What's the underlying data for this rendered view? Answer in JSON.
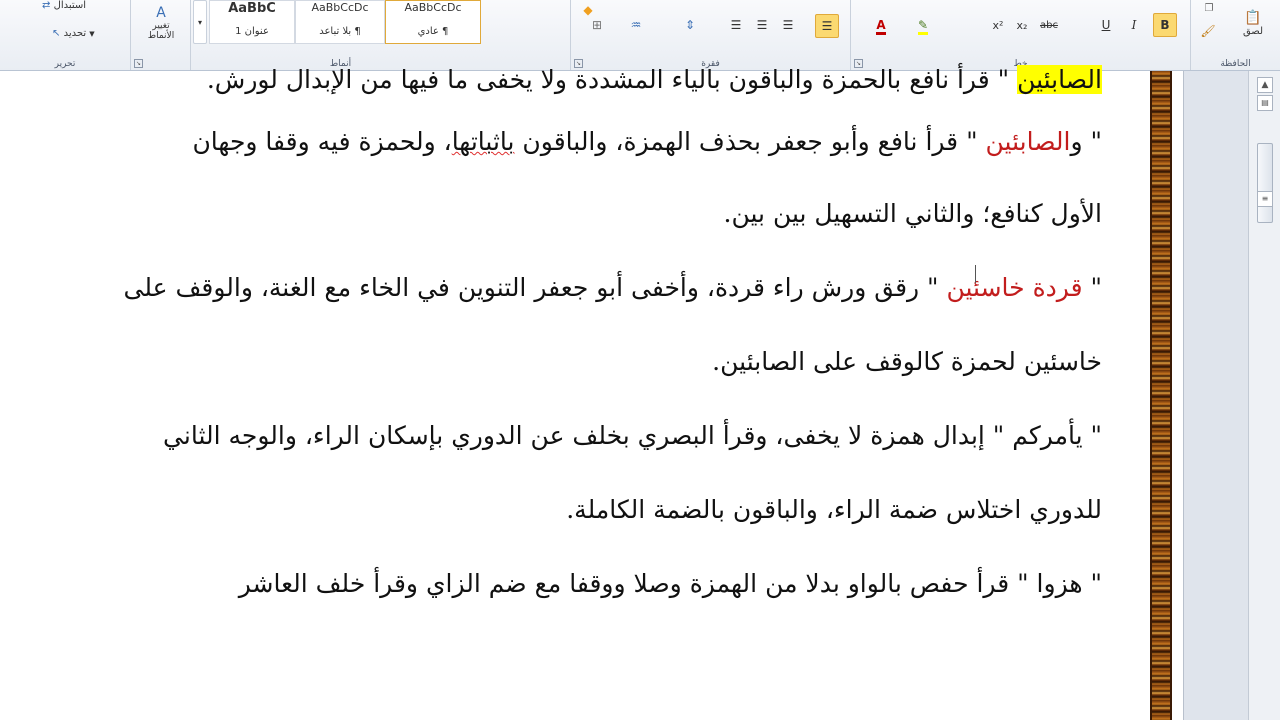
{
  "ribbon": {
    "editing": {
      "label": "تحرير",
      "replace": "استبدال",
      "select": "تحديد"
    },
    "styles": {
      "label": "أنماط",
      "change_styles": "تغيير الأنماط",
      "gallery": [
        {
          "sample": "AaBbCcDc",
          "name": "¶ عادي"
        },
        {
          "sample": "AaBbCcDc",
          "name": "¶ بلا تباعد"
        },
        {
          "sample": "AaBbC",
          "name": "عنوان 1"
        }
      ]
    },
    "paragraph": {
      "label": "فقرة"
    },
    "font": {
      "label": "خط",
      "font_color": "A",
      "superscript": "x²",
      "subscript": "x₂",
      "strike": "abc",
      "underline": "U",
      "italic": "I",
      "bold": "B"
    },
    "clipboard": {
      "label": "الحافظة",
      "paste": "لصق"
    }
  },
  "document": {
    "lines": [
      {
        "segments": [
          {
            "text": "الصابئين",
            "style": "hl"
          },
          {
            "text": " \" قرأ نافع بالحمزة والباقون بالياء المشددة ولا يخفى ما فيها من الإبدال لورش.",
            "style": ""
          }
        ]
      },
      {
        "segments": [
          {
            "text": "\" و",
            "style": ""
          },
          {
            "text": "الصابئين",
            "style": "red"
          },
          {
            "text": " \" قرأ نافع وأبو جعفر بحذف الهمزة، والباقون ",
            "style": ""
          },
          {
            "text": "باثباتها",
            "style": "squiggle"
          },
          {
            "text": "، ولحمزة فيه وقفا وجهان",
            "style": ""
          }
        ]
      },
      {
        "segments": [
          {
            "text": "الأول كنافع؛ والثاني التسهيل بين بين.",
            "style": ""
          }
        ]
      },
      {
        "segments": [
          {
            "text": "\" ",
            "style": ""
          },
          {
            "text": "قردة خاسئين",
            "style": "red"
          },
          {
            "text": " \" رقق ورش راء قردة، وأخفى أبو جعفر التنوين في الخاء مع الغنة، والوقف على",
            "style": ""
          }
        ]
      },
      {
        "segments": [
          {
            "text": "خاسئين لحمزة كالوقف على الصابئين.",
            "style": ""
          }
        ]
      },
      {
        "segments": [
          {
            "text": "\" يأمركم \" إبدال همزة لا يخفى، وقرأ البصري بخلف عن الدوري بإسكان الراء، والوجه الثاني",
            "style": ""
          }
        ]
      },
      {
        "segments": [
          {
            "text": "للدوري اختلاس ضمة الراء، والباقون بالضمة الكاملة.",
            "style": ""
          }
        ]
      },
      {
        "segments": [
          {
            "text": "\" هزوا \" قرأ حفص بالواو بدلا من الهمزة وصلا ووقفا مع ضم الزاي وقرأ خلف العاشر",
            "style": ""
          }
        ]
      }
    ]
  },
  "colors": {
    "ribbon_bg": "#f9fafc",
    "highlight": "#ffff00",
    "quran_word": "#c21d1d",
    "active_button": "#fbd971"
  },
  "icons": [
    "find-icon",
    "select-icon",
    "change-styles-icon",
    "align-right-icon",
    "align-center-icon",
    "align-left-icon",
    "justify-icon",
    "borders-icon",
    "shading-icon",
    "sort-icon",
    "highlight-icon",
    "font-color-icon",
    "paste-icon",
    "format-painter-icon",
    "scroll-up-icon",
    "scroll-down-icon"
  ]
}
